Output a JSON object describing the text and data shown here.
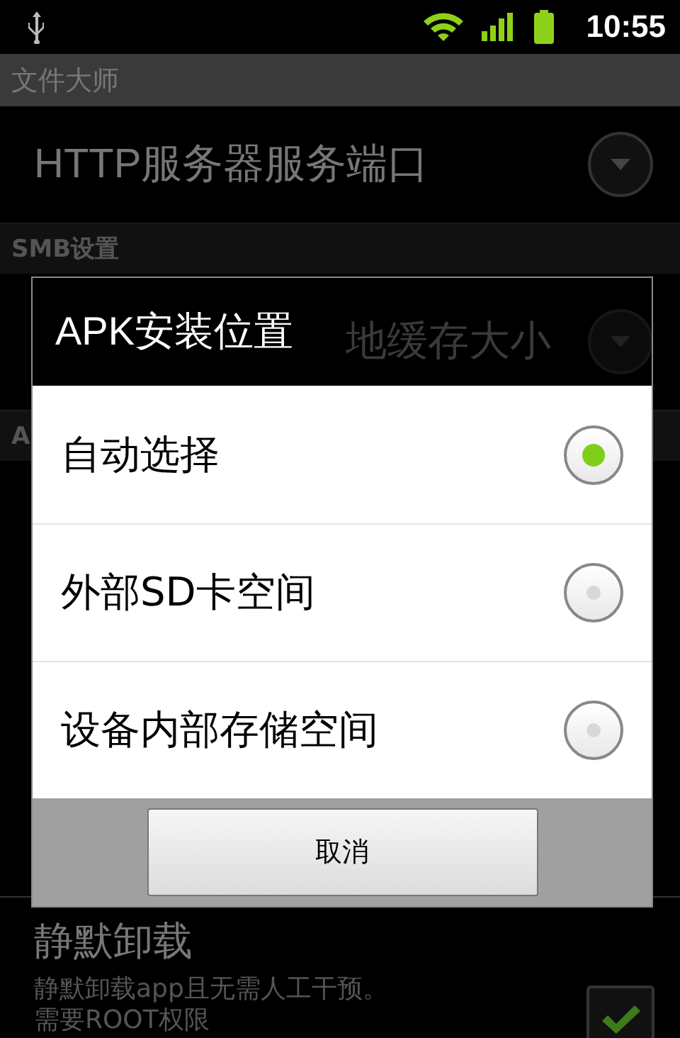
{
  "status_bar": {
    "time": "10:55"
  },
  "title_bar": {
    "title": "文件大师"
  },
  "settings": [
    {
      "kind": "list",
      "title": "HTTP服务器服务端口"
    },
    {
      "kind": "header",
      "title": "SMB设置"
    },
    {
      "kind": "list_partial",
      "title_end": "地缓存大小"
    },
    {
      "kind": "header",
      "title": "A"
    },
    {
      "kind": "spacer"
    },
    {
      "kind": "check",
      "title": "静默卸载",
      "summary": [
        "静默卸载app且无需人工干预。",
        "需要ROOT权限"
      ],
      "checked": true
    }
  ],
  "dialog": {
    "title": "APK安装位置",
    "options": [
      {
        "label": "自动选择",
        "selected": true
      },
      {
        "label": "外部SD卡空间",
        "selected": false
      },
      {
        "label": "设备内部存储空间",
        "selected": false
      }
    ],
    "button": "取消"
  }
}
